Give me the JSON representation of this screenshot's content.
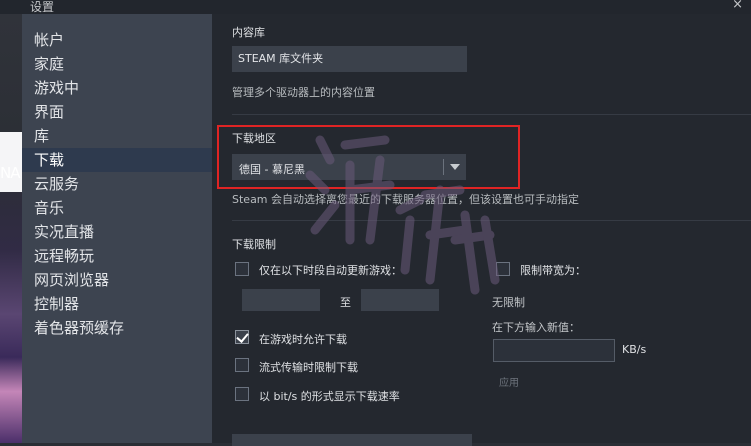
{
  "window": {
    "title": "设置",
    "close_glyph": "×"
  },
  "background": {
    "partial_text": "NA"
  },
  "sidebar": {
    "items": [
      {
        "label": "帐户"
      },
      {
        "label": "家庭"
      },
      {
        "label": "游戏中"
      },
      {
        "label": "界面"
      },
      {
        "label": "库"
      },
      {
        "label": "下载",
        "active": true
      },
      {
        "label": "云服务"
      },
      {
        "label": "音乐"
      },
      {
        "label": "实况直播"
      },
      {
        "label": "远程畅玩"
      },
      {
        "label": "网页浏览器"
      },
      {
        "label": "控制器"
      },
      {
        "label": "着色器预缓存"
      }
    ]
  },
  "content_library": {
    "heading": "内容库",
    "button_label": "STEAM 库文件夹",
    "description": "管理多个驱动器上的内容位置"
  },
  "download_region": {
    "heading": "下载地区",
    "selected": "德国 - 慕尼黑",
    "description": "Steam 会自动选择离您最近的下载服务器位置，但该设置也可手动指定"
  },
  "download_limits": {
    "heading": "下载限制",
    "only_update_between": {
      "label": "仅在以下时段自动更新游戏：",
      "checked": false
    },
    "time_separator": "至",
    "limit_bandwidth": {
      "label": "限制带宽为：",
      "checked": false
    },
    "unlimited_text": "无限制",
    "new_value_label": "在下方输入新值：",
    "unit": "KB/s",
    "apply_label": "应用",
    "allow_during_game": {
      "label": "在游戏时允许下载",
      "checked": true
    },
    "throttle_streaming": {
      "label": "流式传输时限制下载",
      "checked": false
    },
    "show_bits": {
      "label": "以 bit/s 的形式显示下载速率",
      "checked": false
    }
  },
  "colors": {
    "highlight_box": "#e02424",
    "watermark": "#6a5a7a"
  },
  "watermark_icon": "site-watermark"
}
